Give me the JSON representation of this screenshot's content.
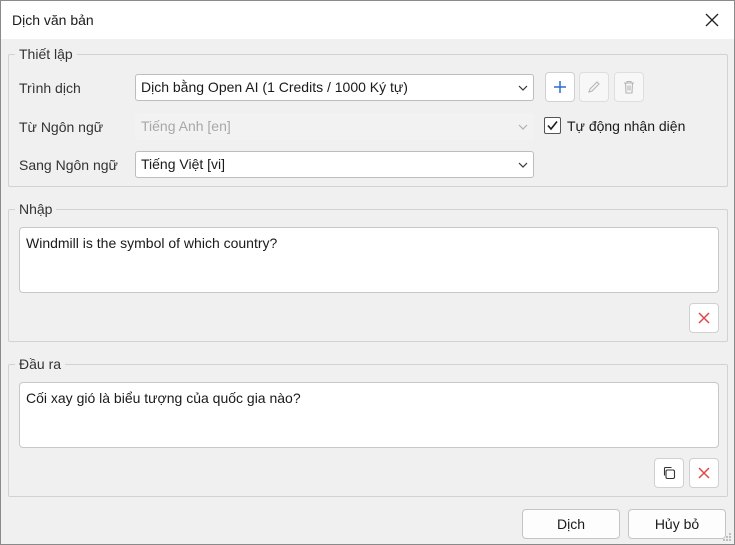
{
  "window": {
    "title": "Dịch văn bản"
  },
  "settings": {
    "legend": "Thiết lập",
    "translator_label": "Trình dịch",
    "translator_value": "Dịch bằng Open AI (1 Credits / 1000 Ký tự)",
    "from_label": "Từ Ngôn ngữ",
    "from_value": "Tiếng Anh [en]",
    "to_label": "Sang Ngôn ngữ",
    "to_value": "Tiếng Việt [vi]",
    "auto_detect_label": "Tự động nhận diện",
    "auto_detect_checked": true
  },
  "input": {
    "legend": "Nhập",
    "text": "Windmill is the symbol of which country?"
  },
  "output": {
    "legend": "Đầu ra",
    "text": "Cối xay gió là biểu tượng của quốc gia nào?"
  },
  "footer": {
    "translate_label": "Dịch",
    "cancel_label": "Hủy bỏ"
  },
  "colors": {
    "accent": "#2b6cd4",
    "danger": "#e04646"
  }
}
